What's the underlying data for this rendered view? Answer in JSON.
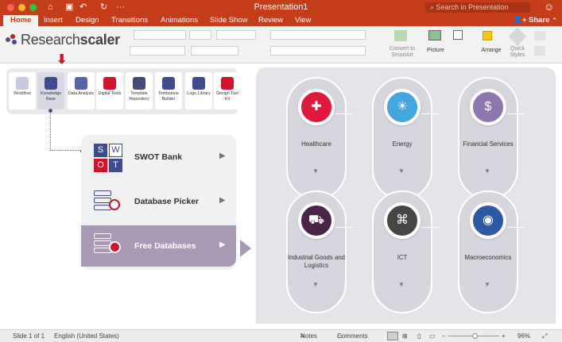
{
  "window": {
    "title": "Presentation1",
    "search_placeholder": "Search in Presentation"
  },
  "tabs": [
    "Home",
    "Insert",
    "Design",
    "Transitions",
    "Animations",
    "Slide Show",
    "Review",
    "View"
  ],
  "share_label": "Share",
  "ribbon": {
    "convert": "Convert to SmartArt",
    "picture": "Picture",
    "arrange": "Arrange",
    "quick_styles": "Quick Styles"
  },
  "logo": {
    "part1": "Research",
    "part2": "scaler"
  },
  "toolbar": [
    {
      "label": "Workflow",
      "icon": "workflow-icon",
      "color": "#c8c8e0"
    },
    {
      "label": "Knowledge Base",
      "icon": "knowledge-base-icon",
      "color": "#3f4b8c"
    },
    {
      "label": "Data Analysis",
      "icon": "data-analysis-icon",
      "color": "#5664a8"
    },
    {
      "label": "Digital Tools",
      "icon": "digital-tools-icon",
      "color": "#d0142c"
    },
    {
      "label": "Template Repository",
      "icon": "template-icon",
      "color": "#444a7a"
    },
    {
      "label": "Tombstone Builder",
      "icon": "tombstone-icon",
      "color": "#3f4b8c"
    },
    {
      "label": "Logo Library",
      "icon": "magnifier-icon",
      "color": "#3f4b8c"
    },
    {
      "label": "Design Tool Kit",
      "icon": "design-kit-icon",
      "color": "#d0142c"
    }
  ],
  "menu": [
    {
      "label": "SWOT Bank"
    },
    {
      "label": "Database Picker"
    },
    {
      "label": "Free Databases"
    }
  ],
  "sectors": [
    {
      "label": "Healthcare",
      "color": "#e0193c",
      "glyph": "✚"
    },
    {
      "label": "Energy",
      "color": "#43a7de",
      "glyph": "☀"
    },
    {
      "label": "Financial Services",
      "color": "#8e77b1",
      "glyph": "$"
    },
    {
      "label": "Industrial Goods and Logistics",
      "color": "#4a2449",
      "glyph": "⛟"
    },
    {
      "label": "ICT",
      "color": "#454545",
      "glyph": "⌘"
    },
    {
      "label": "Macroeconomics",
      "color": "#2e58a4",
      "glyph": "◉"
    }
  ],
  "status": {
    "slide": "Slide 1 of 1",
    "language": "English (United States)",
    "notes": "Notes",
    "comments": "Comments",
    "zoom": "96%"
  }
}
